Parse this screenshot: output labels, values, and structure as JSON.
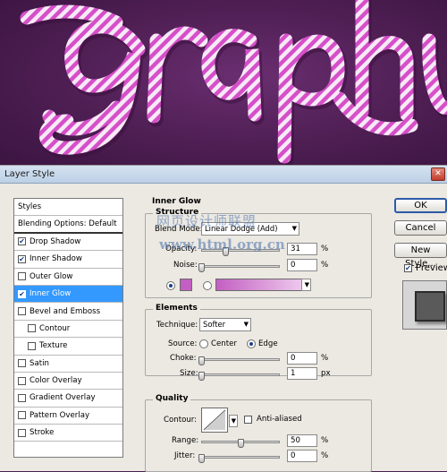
{
  "canvas": {
    "artwork_text": "graphy"
  },
  "dialog": {
    "title": "Layer Style"
  },
  "styles_panel": {
    "header": "Styles",
    "blending_options": "Blending Options: Default",
    "items": [
      {
        "label": "Drop Shadow",
        "checked": true
      },
      {
        "label": "Inner Shadow",
        "checked": true
      },
      {
        "label": "Outer Glow",
        "checked": false
      },
      {
        "label": "Inner Glow",
        "checked": true,
        "selected": true
      },
      {
        "label": "Bevel and Emboss",
        "checked": false
      },
      {
        "label": "Contour",
        "checked": false,
        "sub": true
      },
      {
        "label": "Texture",
        "checked": false,
        "sub": true
      },
      {
        "label": "Satin",
        "checked": false
      },
      {
        "label": "Color Overlay",
        "checked": false
      },
      {
        "label": "Gradient Overlay",
        "checked": false
      },
      {
        "label": "Pattern Overlay",
        "checked": false
      },
      {
        "label": "Stroke",
        "checked": false
      }
    ]
  },
  "inner_glow": {
    "title": "Inner Glow",
    "structure": {
      "legend": "Structure",
      "blend_mode_label": "Blend Mode:",
      "blend_mode_value": "Linear Dodge (Add)",
      "opacity_label": "Opacity:",
      "opacity_value": "31",
      "opacity_level": 0.31,
      "noise_label": "Noise:",
      "noise_value": "0",
      "noise_level": 0,
      "percent": "%",
      "color": "#c35fc2",
      "gradient_from": "#c35fc2",
      "gradient_to": "#f1d2ef"
    },
    "elements": {
      "legend": "Elements",
      "technique_label": "Technique:",
      "technique_value": "Softer",
      "source_label": "Source:",
      "source_center": "Center",
      "source_edge": "Edge",
      "choke_label": "Choke:",
      "choke_value": "0",
      "choke_level": 0,
      "size_label": "Size:",
      "size_value": "1",
      "size_unit": "px",
      "size_level": 0.004
    },
    "quality": {
      "legend": "Quality",
      "contour_label": "Contour:",
      "anti_aliased_label": "Anti-aliased",
      "range_label": "Range:",
      "range_value": "50",
      "range_level": 0.5,
      "jitter_label": "Jitter:",
      "jitter_value": "0",
      "jitter_level": 0
    }
  },
  "buttons": {
    "ok": "OK",
    "cancel": "Cancel",
    "new_style": "New Style...",
    "preview": "Preview"
  },
  "watermark": {
    "line1": "网页设计师联盟",
    "line2": "www.html.org.cn"
  }
}
